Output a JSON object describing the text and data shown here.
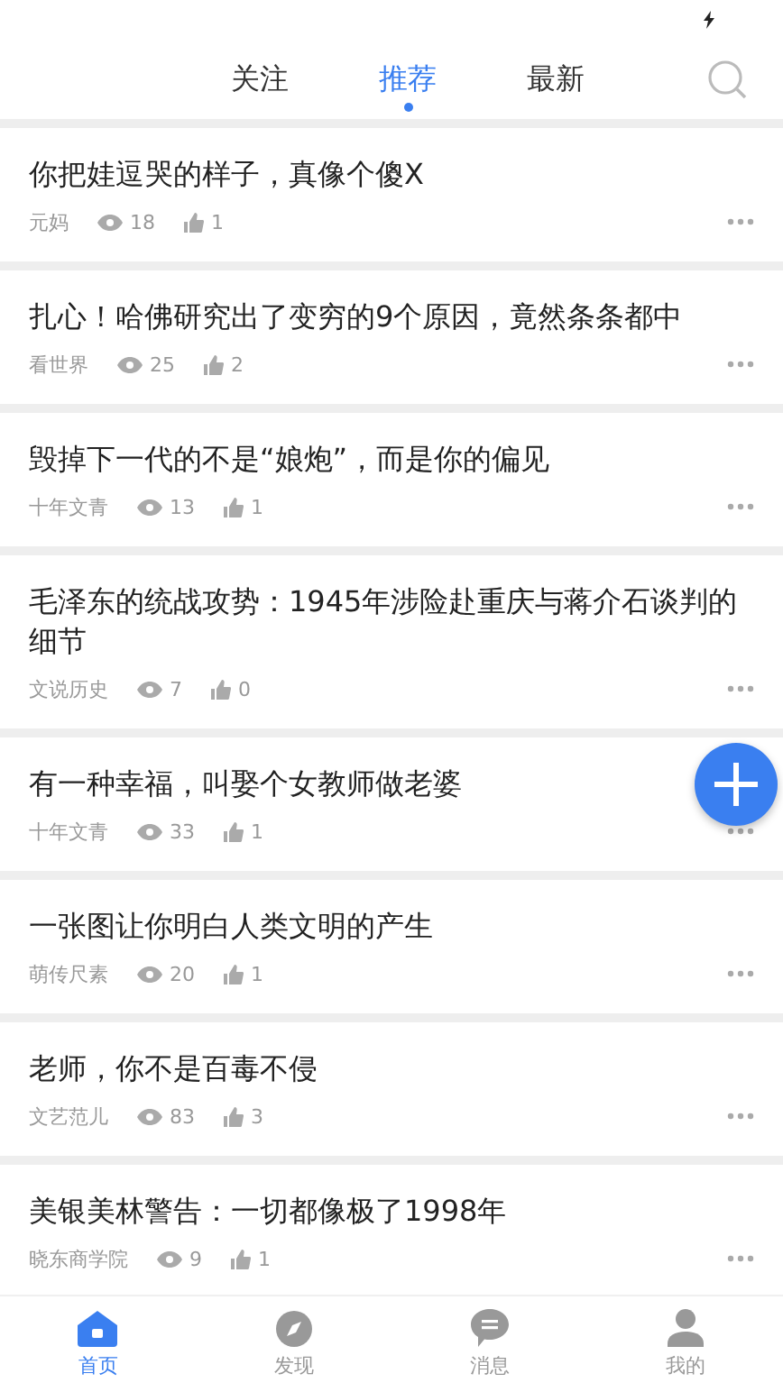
{
  "tabs": [
    {
      "label": "关注",
      "selected": false
    },
    {
      "label": "推荐",
      "selected": true
    },
    {
      "label": "最新",
      "selected": false
    }
  ],
  "articles": [
    {
      "title": "你把娃逗哭的样子，真像个傻X",
      "source": "元妈",
      "views": "18",
      "likes": "1"
    },
    {
      "title": "扎心！哈佛研究出了变穷的9个原因，竟然条条都中",
      "source": "看世界",
      "views": "25",
      "likes": "2"
    },
    {
      "title": "毁掉下一代的不是“娘炮”，而是你的偏见",
      "source": "十年文青",
      "views": "13",
      "likes": "1"
    },
    {
      "title": "毛泽东的统战攻势：1945年涉险赴重庆与蒋介石谈判的细节",
      "source": "文说历史",
      "views": "7",
      "likes": "0"
    },
    {
      "title": "有一种幸福，叫娶个女教师做老婆",
      "source": "十年文青",
      "views": "33",
      "likes": "1"
    },
    {
      "title": "一张图让你明白人类文明的产生",
      "source": "萌传尺素",
      "views": "20",
      "likes": "1"
    },
    {
      "title": "老师，你不是百毒不侵",
      "source": "文艺范儿",
      "views": "83",
      "likes": "3"
    },
    {
      "title": "美银美林警告：一切都像极了1998年",
      "source": "晓东商学院",
      "views": "9",
      "likes": "1"
    }
  ],
  "bottom_nav": [
    {
      "kind": "home",
      "label": "首页",
      "selected": true
    },
    {
      "kind": "discover",
      "label": "发现",
      "selected": false
    },
    {
      "kind": "messages",
      "label": "消息",
      "selected": false
    },
    {
      "kind": "profile",
      "label": "我的",
      "selected": false
    }
  ]
}
